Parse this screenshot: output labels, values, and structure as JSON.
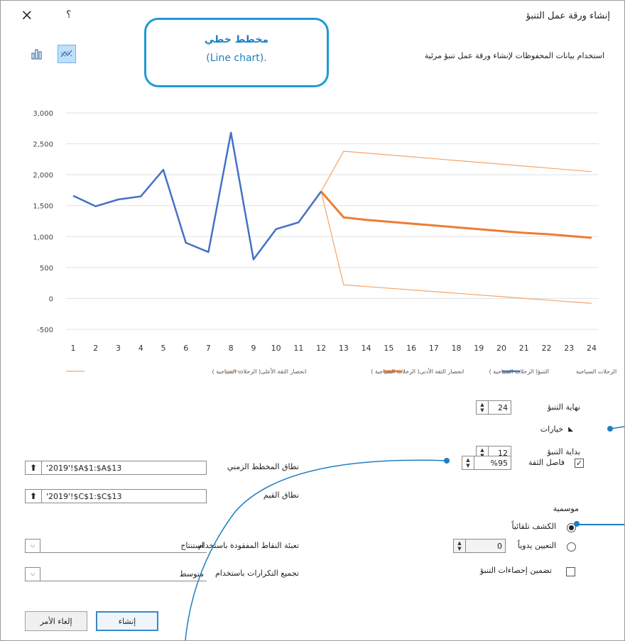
{
  "window": {
    "title": "إنشاء ورقة عمل التنبؤ",
    "close_glyph": "×",
    "help_glyph": "؟",
    "subtitle": "استخدام بيانات المحفوظات لإنشاء ورقة عمل تنبؤ مرئية"
  },
  "callout": {
    "line1": "مخطط خطي",
    "line2": "(Line chart)."
  },
  "chart_data": {
    "type": "line",
    "x": [
      1,
      2,
      3,
      4,
      5,
      6,
      7,
      8,
      9,
      10,
      11,
      12,
      13,
      14,
      15,
      16,
      17,
      18,
      19,
      20,
      21,
      22,
      23,
      24
    ],
    "ylim": [
      -500,
      3000
    ],
    "yticks": [
      "3,000",
      "2,500",
      "2,000",
      "1,500",
      "1,000",
      "500",
      "0",
      "-500"
    ],
    "ytick_values": [
      3000,
      2500,
      2000,
      1500,
      1000,
      500,
      0,
      -500
    ],
    "grid": true,
    "legend_position": "bottom",
    "series": [
      {
        "name": "الرحلات السياحية",
        "color": "#4472c4",
        "width": 2.5,
        "x": [
          1,
          2,
          3,
          4,
          5,
          6,
          7,
          8,
          9,
          10,
          11,
          12
        ],
        "values": [
          1660,
          1490,
          1600,
          1650,
          2080,
          900,
          750,
          2680,
          630,
          1120,
          1230,
          1730
        ]
      },
      {
        "name": "التنبؤ( الرحلات السياحية )",
        "color": "#ed7d31",
        "width": 3,
        "x": [
          12,
          13,
          14,
          15,
          16,
          17,
          18,
          19,
          20,
          21,
          22,
          23,
          24
        ],
        "values": [
          1730,
          1310,
          1270,
          1240,
          1210,
          1180,
          1150,
          1120,
          1090,
          1060,
          1040,
          1010,
          980
        ]
      },
      {
        "name": "انحصار الثقة الأدنى( الرحلات السياحية )",
        "color": "#f4a46a",
        "width": 1.2,
        "x": [
          12,
          13,
          24
        ],
        "values": [
          1730,
          220,
          -80
        ]
      },
      {
        "name": "انحصار الثقة الأعلى( الرحلات السياحية )",
        "color": "#f4a46a",
        "width": 1.2,
        "x": [
          12,
          13,
          24
        ],
        "values": [
          1730,
          2380,
          2050
        ]
      }
    ]
  },
  "options": {
    "forecast_end_label": "نهاية التنبؤ",
    "forecast_end_value": "24",
    "options_label": "خيارات",
    "forecast_start_label": "بداية التنبؤ",
    "forecast_start_value": "12",
    "confidence_label": "فاصل الثقة",
    "confidence_value": "%95",
    "confidence_checked": true,
    "seasonality_label": "موسمية",
    "auto_detect_label": "الكشف تلقائياً",
    "manual_label": "التعيين يدوياً",
    "manual_value": "0",
    "include_stats_label": "تضمين إحصاءات التنبؤ",
    "timeline_range_label": "نطاق المخطط الزمني",
    "timeline_range_value": "'2019'!$A$1:$A$13",
    "values_range_label": "نطاق القيم",
    "values_range_value": "'2019'!$C$1:$C$13",
    "fill_missing_label": "تعبئة النقاط المفقودة باستخدام",
    "fill_missing_value": "استنتاج",
    "aggregate_label": "تجميع التكرارات باستخدام",
    "aggregate_value": "متوسط",
    "upload_glyph": "⬆",
    "dropdown_glyph": "⌵"
  },
  "buttons": {
    "create": "إنشاء",
    "cancel": "إلغاء الأمر"
  },
  "colors": {
    "accent": "#1d9ad6",
    "history": "#4472c4",
    "forecast": "#ed7d31",
    "bounds": "#f4a46a"
  }
}
